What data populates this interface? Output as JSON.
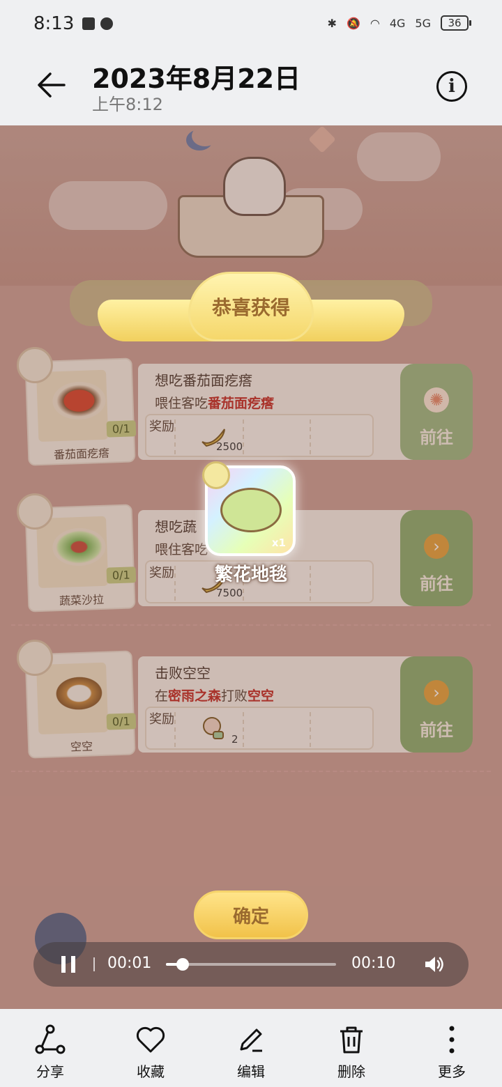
{
  "status_bar": {
    "time": "8:13",
    "battery": "36",
    "network_1": "4G",
    "network_2": "5G"
  },
  "header": {
    "title": "2023年8月22日",
    "subtitle": "上午8:12"
  },
  "game": {
    "banner_title": "恭喜获得",
    "tasks": [
      {
        "image_label": "番茄面疙瘩",
        "count": "0/1",
        "title": "想吃番茄面疙瘩",
        "desc_prefix": "喂住客吃",
        "desc_highlight": "番茄面疙瘩",
        "reward_label": "奖励",
        "reward_amount": "2500",
        "go_label": "前往"
      },
      {
        "image_label": "蔬菜沙拉",
        "count": "0/1",
        "title": "想吃蔬",
        "desc_prefix": "喂住客吃",
        "desc_highlight": "",
        "reward_label": "奖励",
        "reward_amount": "7500",
        "go_label": "前往"
      },
      {
        "image_label": "空空",
        "count": "0/1",
        "title": "击败空空",
        "desc_1": "在",
        "desc_hl_1": "密雨之森",
        "desc_2": "打败",
        "desc_hl_2": "空空",
        "reward_label": "奖励",
        "reward_amount": "2",
        "go_label": "前往"
      }
    ],
    "reward_item": {
      "name": "繁花地毯",
      "quantity": "x1"
    },
    "confirm_label": "确定"
  },
  "player": {
    "current_time": "00:01",
    "total_time": "00:10",
    "progress": 0.1
  },
  "toolbar": {
    "share": "分享",
    "favorite": "收藏",
    "edit": "编辑",
    "delete": "删除",
    "more": "更多"
  }
}
